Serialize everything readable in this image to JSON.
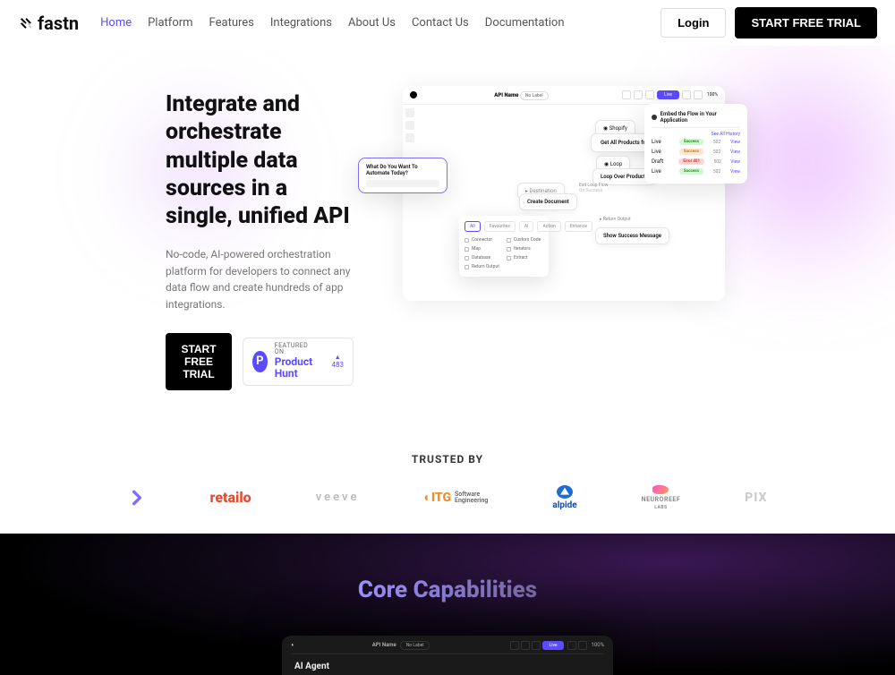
{
  "brand": "fastn",
  "nav": {
    "items": [
      "Home",
      "Platform",
      "Features",
      "Integrations",
      "About Us",
      "Contact Us",
      "Documentation"
    ],
    "active_index": 0,
    "login": "Login",
    "trial": "START FREE TRIAL"
  },
  "hero": {
    "title": "Integrate and orchestrate multiple data sources in a single, unified API",
    "subtitle": "No-code, AI-powered orchestration platform for developers to connect any data flow and create hundreds of app integrations.",
    "trial": "START FREE TRIAL",
    "ph": {
      "featured": "FEATURED ON",
      "name": "Product Hunt",
      "count": "483"
    }
  },
  "app": {
    "api_label": "API Name",
    "no_label": "No Label",
    "blue_btn": "Live",
    "zoom": "100%",
    "prompt_q": "What Do You Want To Automate Today?",
    "table": {
      "header": "Embed the Flow in Your Application",
      "see_all": "See All History",
      "rows": [
        {
          "name": "Live",
          "status": "Success",
          "code": "502",
          "action": "View"
        },
        {
          "name": "Live",
          "status": "Success",
          "code": "502",
          "action": "View"
        },
        {
          "name": "Draft",
          "status": "Error 401",
          "code": "502",
          "action": "View"
        },
        {
          "name": "Live",
          "status": "Success",
          "code": "502",
          "action": "View"
        }
      ]
    },
    "nodes": {
      "shopify": "Shopify",
      "getall": "Get All Products from Shopify",
      "loop": "Loop",
      "loopover": "Loop Over Products",
      "dest": "Destination",
      "create": "Create Document",
      "exit_label": "Exit Loop Flow",
      "exit_sub": "On Success",
      "showmsg_label": "Return Output",
      "showmsg": "Show Success Message"
    },
    "panel": {
      "tabs": [
        "All",
        "Favourites",
        "AI",
        "Action",
        "Enhance"
      ],
      "left": [
        "Connector",
        "Map",
        "Database",
        "Return Output"
      ],
      "right": [
        "Custom Code",
        "Iterators",
        "Extract"
      ]
    }
  },
  "trusted": {
    "title": "TRUSTED BY",
    "logos": {
      "retailo": "retailo",
      "veeve": "veeve",
      "itg": "ITG",
      "itg_sub1": "Software",
      "itg_sub2": "Engineering",
      "alpide": "alpide",
      "neuroreef": "NEUROREEF",
      "neuroreef_sub": "LABS",
      "pixl": "PIX"
    }
  },
  "core": {
    "title": "Core Capabilities",
    "api_label": "API Name",
    "no_label": "No Label",
    "blue_btn": "Live",
    "zoom": "100%",
    "agent": "AI Agent"
  }
}
